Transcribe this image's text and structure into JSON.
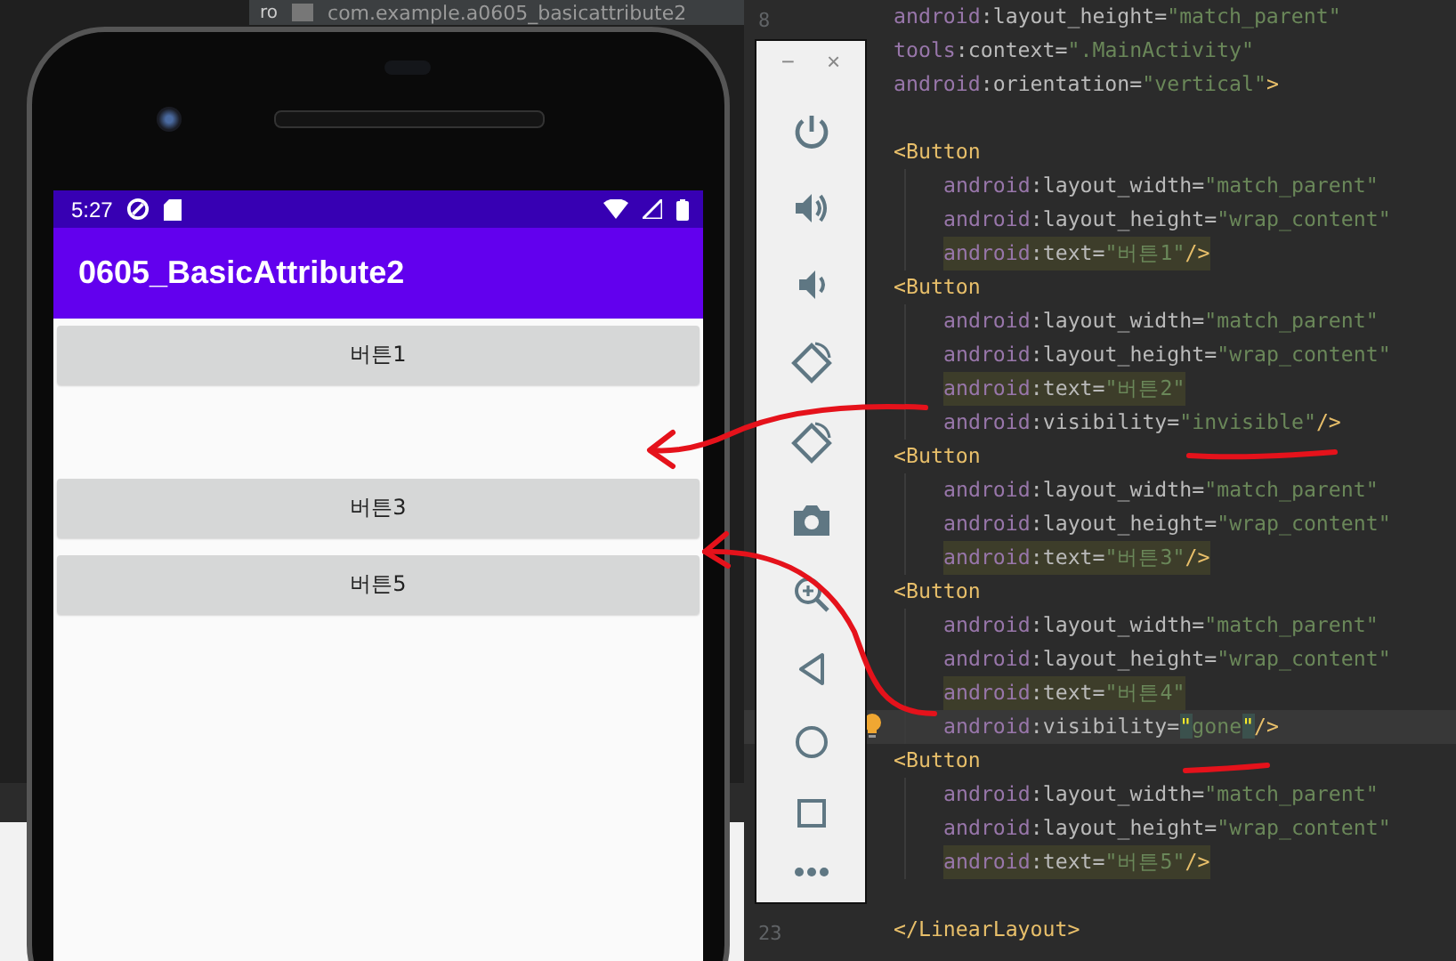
{
  "editor_tab": {
    "side_label": "ro",
    "title": "com.example.a0605_basicattribute2"
  },
  "phone": {
    "status_bar": {
      "time": "5:27"
    },
    "app_bar": {
      "title": "0605_BasicAttribute2"
    },
    "buttons": [
      {
        "kind": "button",
        "label": "버튼1"
      },
      {
        "kind": "blank"
      },
      {
        "kind": "button",
        "label": "버튼3"
      },
      {
        "kind": "button",
        "label": "버튼5"
      }
    ]
  },
  "emulator_toolbar": {
    "minimize": "−",
    "close": "×",
    "tools": [
      {
        "kind": "power"
      },
      {
        "kind": "volume-up"
      },
      {
        "kind": "volume-down"
      },
      {
        "kind": "rotate-left"
      },
      {
        "kind": "rotate-right"
      },
      {
        "kind": "camera"
      },
      {
        "kind": "zoom"
      },
      {
        "kind": "back"
      },
      {
        "kind": "home"
      },
      {
        "kind": "overview"
      },
      {
        "kind": "more"
      }
    ]
  },
  "code": {
    "lines": [
      {
        "kind": "code",
        "number": "8",
        "tokens": [
          {
            "kind": "ns",
            "text": "android"
          },
          {
            "kind": "p",
            "text": ":"
          },
          {
            "kind": "attr",
            "text": "layout_height"
          },
          {
            "kind": "p",
            "text": "="
          },
          {
            "kind": "val",
            "text": "\"match_parent\""
          }
        ]
      },
      {
        "kind": "code",
        "tokens": [
          {
            "kind": "ns",
            "text": "tools"
          },
          {
            "kind": "p",
            "text": ":"
          },
          {
            "kind": "attr",
            "text": "context"
          },
          {
            "kind": "p",
            "text": "="
          },
          {
            "kind": "val",
            "text": "\".MainActivity\""
          }
        ]
      },
      {
        "kind": "code",
        "tokens": [
          {
            "kind": "ns",
            "text": "android"
          },
          {
            "kind": "p",
            "text": ":"
          },
          {
            "kind": "attr",
            "text": "orientation"
          },
          {
            "kind": "p",
            "text": "="
          },
          {
            "kind": "val",
            "text": "\"vertical\""
          },
          {
            "kind": "tag",
            "text": ">"
          }
        ]
      },
      {
        "kind": "blank"
      },
      {
        "kind": "code",
        "tokens": [
          {
            "kind": "tag",
            "text": "<Button"
          }
        ],
        "children": [
          {
            "kind": "code",
            "tokens": [
              {
                "kind": "ns",
                "text": "android"
              },
              {
                "kind": "p",
                "text": ":"
              },
              {
                "kind": "attr",
                "text": "layout_width"
              },
              {
                "kind": "p",
                "text": "="
              },
              {
                "kind": "val",
                "text": "\"match_parent\""
              }
            ]
          },
          {
            "kind": "code",
            "tokens": [
              {
                "kind": "ns",
                "text": "android"
              },
              {
                "kind": "p",
                "text": ":"
              },
              {
                "kind": "attr",
                "text": "layout_height"
              },
              {
                "kind": "p",
                "text": "="
              },
              {
                "kind": "val",
                "text": "\"wrap_content\""
              }
            ]
          },
          {
            "kind": "code",
            "highlighted": true,
            "tokens": [
              {
                "kind": "ns",
                "text": "android"
              },
              {
                "kind": "p",
                "text": ":"
              },
              {
                "kind": "attr",
                "text": "text"
              },
              {
                "kind": "p",
                "text": "="
              },
              {
                "kind": "val",
                "text": "\"버튼1\""
              },
              {
                "kind": "tag",
                "text": "/>"
              }
            ]
          }
        ]
      },
      {
        "kind": "code",
        "tokens": [
          {
            "kind": "tag",
            "text": "<Button"
          }
        ],
        "children": [
          {
            "kind": "code",
            "tokens": [
              {
                "kind": "ns",
                "text": "android"
              },
              {
                "kind": "p",
                "text": ":"
              },
              {
                "kind": "attr",
                "text": "layout_width"
              },
              {
                "kind": "p",
                "text": "="
              },
              {
                "kind": "val",
                "text": "\"match_parent\""
              }
            ]
          },
          {
            "kind": "code",
            "tokens": [
              {
                "kind": "ns",
                "text": "android"
              },
              {
                "kind": "p",
                "text": ":"
              },
              {
                "kind": "attr",
                "text": "layout_height"
              },
              {
                "kind": "p",
                "text": "="
              },
              {
                "kind": "val",
                "text": "\"wrap_content\""
              }
            ]
          },
          {
            "kind": "code",
            "highlighted": true,
            "tokens": [
              {
                "kind": "ns",
                "text": "android"
              },
              {
                "kind": "p",
                "text": ":"
              },
              {
                "kind": "attr",
                "text": "text"
              },
              {
                "kind": "p",
                "text": "="
              },
              {
                "kind": "val",
                "text": "\"버튼2\""
              }
            ]
          },
          {
            "kind": "code",
            "tokens": [
              {
                "kind": "ns",
                "text": "android"
              },
              {
                "kind": "p",
                "text": ":"
              },
              {
                "kind": "attr",
                "text": "visibility"
              },
              {
                "kind": "p",
                "text": "="
              },
              {
                "kind": "val",
                "text": "\"invisible\""
              },
              {
                "kind": "tag",
                "text": "/>"
              }
            ]
          }
        ]
      },
      {
        "kind": "code",
        "tokens": [
          {
            "kind": "tag",
            "text": "<Button"
          }
        ],
        "children": [
          {
            "kind": "code",
            "tokens": [
              {
                "kind": "ns",
                "text": "android"
              },
              {
                "kind": "p",
                "text": ":"
              },
              {
                "kind": "attr",
                "text": "layout_width"
              },
              {
                "kind": "p",
                "text": "="
              },
              {
                "kind": "val",
                "text": "\"match_parent\""
              }
            ]
          },
          {
            "kind": "code",
            "tokens": [
              {
                "kind": "ns",
                "text": "android"
              },
              {
                "kind": "p",
                "text": ":"
              },
              {
                "kind": "attr",
                "text": "layout_height"
              },
              {
                "kind": "p",
                "text": "="
              },
              {
                "kind": "val",
                "text": "\"wrap_content\""
              }
            ]
          },
          {
            "kind": "code",
            "highlighted": true,
            "tokens": [
              {
                "kind": "ns",
                "text": "android"
              },
              {
                "kind": "p",
                "text": ":"
              },
              {
                "kind": "attr",
                "text": "text"
              },
              {
                "kind": "p",
                "text": "="
              },
              {
                "kind": "val",
                "text": "\"버튼3\""
              },
              {
                "kind": "tag",
                "text": "/>"
              }
            ]
          }
        ]
      },
      {
        "kind": "code",
        "tokens": [
          {
            "kind": "tag",
            "text": "<Button"
          }
        ],
        "children": [
          {
            "kind": "code",
            "tokens": [
              {
                "kind": "ns",
                "text": "android"
              },
              {
                "kind": "p",
                "text": ":"
              },
              {
                "kind": "attr",
                "text": "layout_width"
              },
              {
                "kind": "p",
                "text": "="
              },
              {
                "kind": "val",
                "text": "\"match_parent\""
              }
            ]
          },
          {
            "kind": "code",
            "tokens": [
              {
                "kind": "ns",
                "text": "android"
              },
              {
                "kind": "p",
                "text": ":"
              },
              {
                "kind": "attr",
                "text": "layout_height"
              },
              {
                "kind": "p",
                "text": "="
              },
              {
                "kind": "val",
                "text": "\"wrap_content\""
              }
            ]
          },
          {
            "kind": "code",
            "highlighted": true,
            "tokens": [
              {
                "kind": "ns",
                "text": "android"
              },
              {
                "kind": "p",
                "text": ":"
              },
              {
                "kind": "attr",
                "text": "text"
              },
              {
                "kind": "p",
                "text": "="
              },
              {
                "kind": "val",
                "text": "\"버튼4\""
              }
            ]
          },
          {
            "kind": "code",
            "current": true,
            "lightbulb": true,
            "tokens": [
              {
                "kind": "ns",
                "text": "android"
              },
              {
                "kind": "p",
                "text": ":"
              },
              {
                "kind": "attr",
                "text": "visibility"
              },
              {
                "kind": "p",
                "text": "="
              },
              {
                "kind": "match",
                "text": "\""
              },
              {
                "kind": "val",
                "text": "gone"
              },
              {
                "kind": "match",
                "text": "\""
              },
              {
                "kind": "tag",
                "text": "/>"
              }
            ]
          }
        ]
      },
      {
        "kind": "code",
        "tokens": [
          {
            "kind": "tag",
            "text": "<Button"
          }
        ],
        "children": [
          {
            "kind": "code",
            "tokens": [
              {
                "kind": "ns",
                "text": "android"
              },
              {
                "kind": "p",
                "text": ":"
              },
              {
                "kind": "attr",
                "text": "layout_width"
              },
              {
                "kind": "p",
                "text": "="
              },
              {
                "kind": "val",
                "text": "\"match_parent\""
              }
            ]
          },
          {
            "kind": "code",
            "tokens": [
              {
                "kind": "ns",
                "text": "android"
              },
              {
                "kind": "p",
                "text": ":"
              },
              {
                "kind": "attr",
                "text": "layout_height"
              },
              {
                "kind": "p",
                "text": "="
              },
              {
                "kind": "val",
                "text": "\"wrap_content\""
              }
            ]
          },
          {
            "kind": "code",
            "highlighted": true,
            "tokens": [
              {
                "kind": "ns",
                "text": "android"
              },
              {
                "kind": "p",
                "text": ":"
              },
              {
                "kind": "attr",
                "text": "text"
              },
              {
                "kind": "p",
                "text": "="
              },
              {
                "kind": "val",
                "text": "\"버튼5\""
              },
              {
                "kind": "tag",
                "text": "/>"
              }
            ]
          }
        ]
      },
      {
        "kind": "blank"
      },
      {
        "kind": "code",
        "number": "23",
        "tokens": [
          {
            "kind": "tag",
            "text": "</LinearLayout>"
          }
        ]
      }
    ]
  }
}
